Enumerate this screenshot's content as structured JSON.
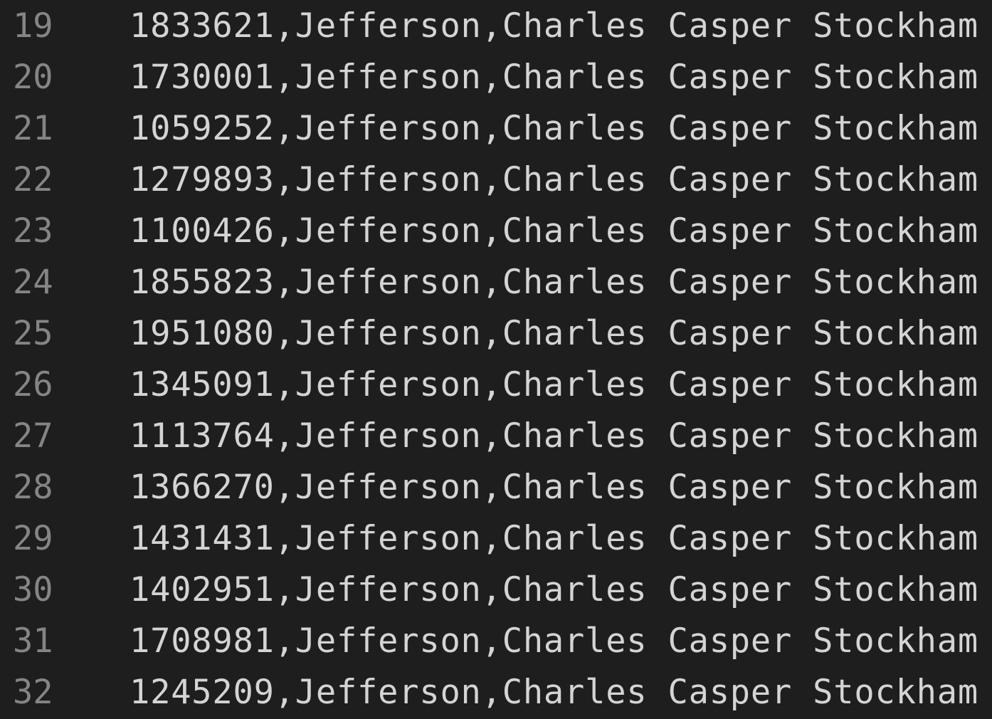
{
  "editor": {
    "lines": [
      {
        "number": "19",
        "text": "1833621,Jefferson,Charles Casper Stockham"
      },
      {
        "number": "20",
        "text": "1730001,Jefferson,Charles Casper Stockham"
      },
      {
        "number": "21",
        "text": "1059252,Jefferson,Charles Casper Stockham"
      },
      {
        "number": "22",
        "text": "1279893,Jefferson,Charles Casper Stockham"
      },
      {
        "number": "23",
        "text": "1100426,Jefferson,Charles Casper Stockham"
      },
      {
        "number": "24",
        "text": "1855823,Jefferson,Charles Casper Stockham"
      },
      {
        "number": "25",
        "text": "1951080,Jefferson,Charles Casper Stockham"
      },
      {
        "number": "26",
        "text": "1345091,Jefferson,Charles Casper Stockham"
      },
      {
        "number": "27",
        "text": "1113764,Jefferson,Charles Casper Stockham"
      },
      {
        "number": "28",
        "text": "1366270,Jefferson,Charles Casper Stockham"
      },
      {
        "number": "29",
        "text": "1431431,Jefferson,Charles Casper Stockham"
      },
      {
        "number": "30",
        "text": "1402951,Jefferson,Charles Casper Stockham"
      },
      {
        "number": "31",
        "text": "1708981,Jefferson,Charles Casper Stockham"
      },
      {
        "number": "32",
        "text": "1245209,Jefferson,Charles Casper Stockham"
      }
    ]
  },
  "colors": {
    "background": "#1e1e1e",
    "line_number": "#858585",
    "text": "#d4d4d4"
  }
}
